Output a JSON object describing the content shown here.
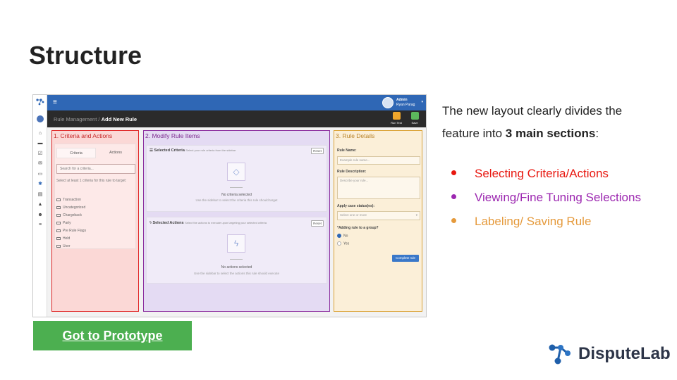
{
  "slide": {
    "title": "Structure",
    "intro_prefix": "The new layout clearly divides the feature into ",
    "intro_bold": "3 main sections",
    "intro_suffix": ":",
    "bullets": [
      {
        "text": "Selecting Criteria/Actions",
        "color": "#e8170f"
      },
      {
        "text": "Viewing/Fine Tuning Selections",
        "color": "#9c27b0"
      },
      {
        "text": "Labeling/ Saving Rule",
        "color": "#e59a3c"
      }
    ],
    "prototype_button": "Got to Prototype",
    "brand_name": "DisputeLab"
  },
  "app": {
    "user": {
      "role": "Admin",
      "name": "Ryan Parag"
    },
    "breadcrumb": {
      "parent": "Rule Management",
      "separator": "/",
      "current": "Add New Rule"
    },
    "toolbar": {
      "run_test": "Run Test",
      "save": "Save"
    },
    "criteria_panel": {
      "title": "1. Criteria and Actions",
      "tabs": [
        "Criteria",
        "Actions"
      ],
      "search_placeholder": "Search for a criteria...",
      "hint": "Select at least 1 criteria for this rule to target:",
      "items": [
        "Transaction",
        "Uncategorized",
        "Chargeback",
        "Party",
        "Pre Rule Flags",
        "Held",
        "User"
      ]
    },
    "modify_panel": {
      "title": "2. Modify Rule Items",
      "criteria_section": {
        "heading": "Selected Criteria",
        "sub": "Select your rule criteria from the sidebar",
        "reset": "Reset",
        "empty_title": "No criteria selected",
        "empty_sub": "Use the sidebar to select the criteria this rule should target"
      },
      "actions_section": {
        "heading": "Selected Actions",
        "sub": "Select the actions to execute upon targeting your selected criteria",
        "reset": "Reset",
        "empty_title": "No actions selected",
        "empty_sub": "Use the sidebar to select the actions this rule should execute"
      }
    },
    "details_panel": {
      "title": "3. Rule Details",
      "rule_name_label": "Rule Name:",
      "rule_name_placeholder": "Example rule name...",
      "rule_desc_label": "Rule Description:",
      "rule_desc_placeholder": "Describe your rule...",
      "case_status_label": "Apply case status(es):",
      "case_status_placeholder": "Select one or more",
      "group_label": "*Adding rule to a group?",
      "options": [
        "No",
        "Yes"
      ],
      "complete_button": "Complete rule"
    }
  },
  "colors": {
    "criteria_border": "#e02424",
    "modify_border": "#8b2c9e",
    "details_border": "#dba234",
    "topbar": "#2f67b5",
    "prototype_button": "#4caf50"
  }
}
